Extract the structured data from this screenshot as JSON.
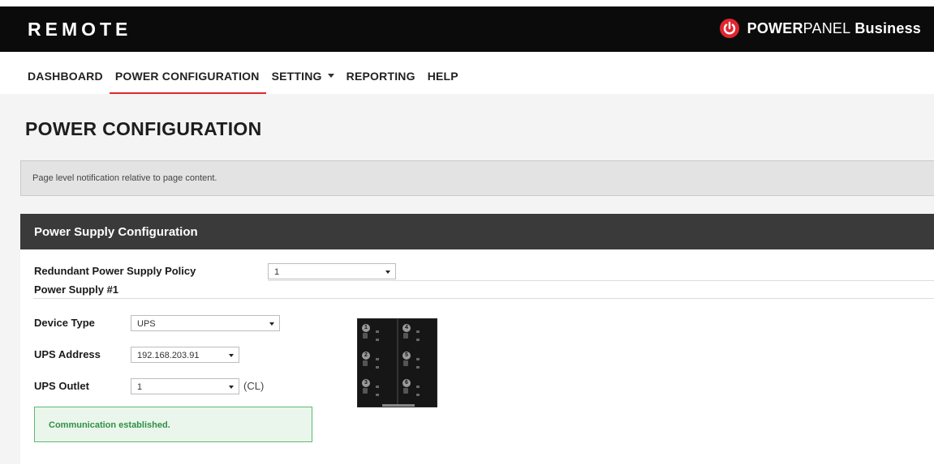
{
  "header": {
    "app_name": "REMOTE",
    "logo_word1": "POWER",
    "logo_word2": "PANEL",
    "logo_word3": "Business",
    "logo_color": "#e0262f"
  },
  "nav": {
    "items": [
      {
        "label": "DASHBOARD"
      },
      {
        "label": "POWER CONFIGURATION",
        "active": true
      },
      {
        "label": "SETTING",
        "has_dropdown": true
      },
      {
        "label": "REPORTING"
      },
      {
        "label": "HELP"
      }
    ],
    "active_color": "#e0262f"
  },
  "page": {
    "title": "POWER CONFIGURATION",
    "notification": "Page level notification relative to page content."
  },
  "panel": {
    "title": "Power Supply Configuration",
    "policy_label": "Redundant Power Supply Policy",
    "policy_value": "1",
    "section_title": "Power Supply #1",
    "device_type_label": "Device Type",
    "device_type_value": "UPS",
    "ups_address_label": "UPS Address",
    "ups_address_value": "192.168.203.91",
    "ups_outlet_label": "UPS Outlet",
    "ups_outlet_value": "1",
    "ups_outlet_suffix": "(CL)",
    "status_message": "Communication established.",
    "status_color": "#2f8f45"
  },
  "outlets": {
    "left": [
      "1",
      "2",
      "3"
    ],
    "right": [
      "4",
      "5",
      "6"
    ]
  }
}
